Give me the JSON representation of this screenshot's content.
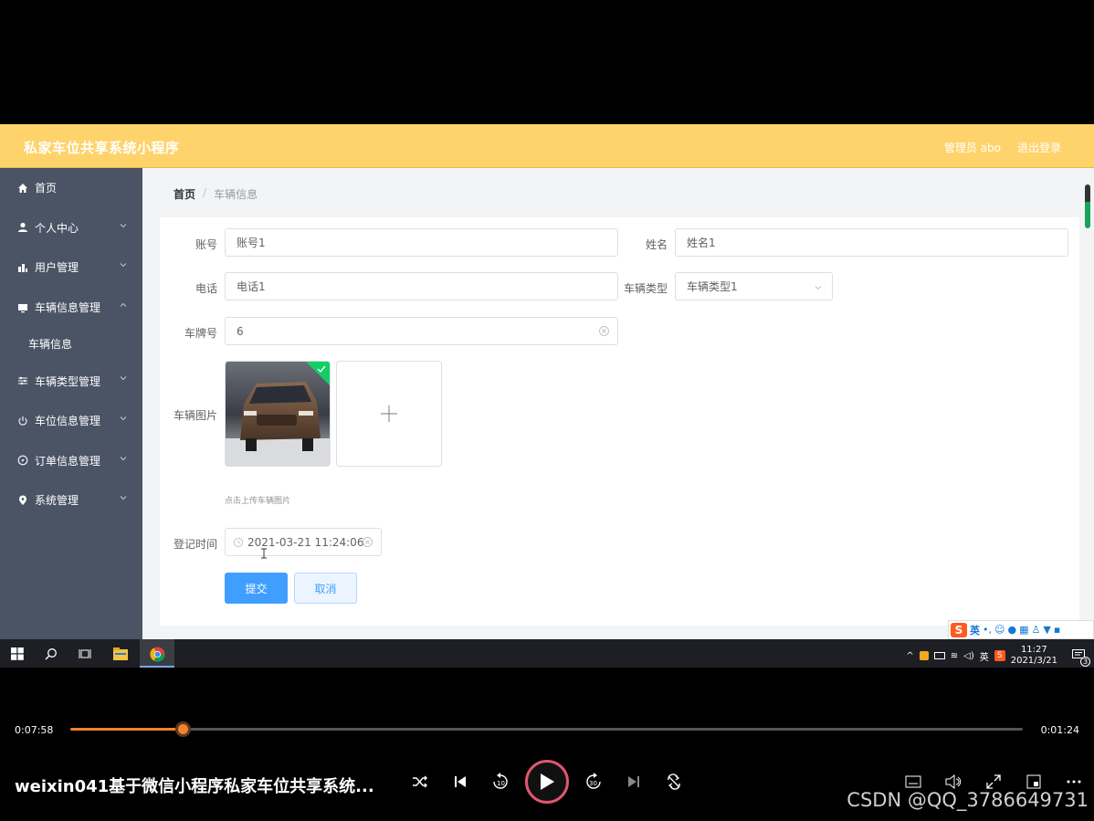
{
  "app": {
    "title": "私家车位共享系统小程序",
    "admin_label": "管理员 abo",
    "logout_label": "退出登录"
  },
  "sidebar": {
    "items": [
      {
        "label": "首页",
        "icon": "home-icon"
      },
      {
        "label": "个人中心",
        "icon": "user-icon"
      },
      {
        "label": "用户管理",
        "icon": "chart-icon"
      },
      {
        "label": "车辆信息管理",
        "icon": "monitor-icon"
      },
      {
        "label": "车辆类型管理",
        "icon": "sliders-icon"
      },
      {
        "label": "车位信息管理",
        "icon": "power-icon"
      },
      {
        "label": "订单信息管理",
        "icon": "compass-icon"
      },
      {
        "label": "系统管理",
        "icon": "location-icon"
      }
    ],
    "sub_item": "车辆信息"
  },
  "breadcrumb": {
    "home": "首页",
    "sep": "/",
    "current": "车辆信息"
  },
  "form": {
    "account_label": "账号",
    "account_value": "账号1",
    "name_label": "姓名",
    "name_value": "姓名1",
    "phone_label": "电话",
    "phone_value": "电话1",
    "type_label": "车辆类型",
    "type_value": "车辆类型1",
    "plate_label": "车牌号",
    "plate_value": "6",
    "image_label": "车辆图片",
    "image_hint": "点击上传车辆图片",
    "time_label": "登记时间",
    "time_value": "2021-03-21 11:24:06",
    "submit_label": "提交",
    "cancel_label": "取消"
  },
  "ime": {
    "lang": "英"
  },
  "taskbar": {
    "tray_lang": "英",
    "time": "11:27",
    "date": "2021/3/21",
    "notif_count": "3"
  },
  "player": {
    "current_time": "0:07:58",
    "total_time": "0:01:24",
    "progress": 0.118,
    "title": "weixin041基于微信小程序私家车位共享系统...",
    "watermark": "CSDN @QQ_3786649731"
  },
  "colors": {
    "header": "#ffd36b",
    "sidebar": "#4a5465",
    "primary": "#409eff",
    "accent": "#f5822a"
  }
}
